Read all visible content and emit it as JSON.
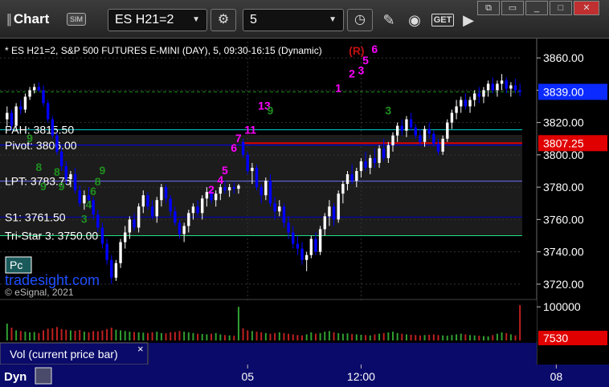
{
  "toolbar": {
    "app_title": "Chart",
    "sim_badge": "SIM",
    "symbol": "ES H21=2",
    "interval": "5",
    "get_label": "GET"
  },
  "chart_header": "* ES H21=2, S&P 500 FUTURES E-MINI (DAY), 5, 09:30-16:15 (Dynamic)",
  "watermark": {
    "brand": "tradesight.com",
    "copyright": "© eSignal, 2021",
    "pc_badge": "Pc"
  },
  "volume_panel": {
    "label": "Vol (current price bar)",
    "close_x": "×",
    "last_volume": "7530"
  },
  "footer": {
    "dyn_label": "Dyn"
  },
  "colors": {
    "up": "#ffffff",
    "down": "#0000ff",
    "setup_green": "#1f8f1f",
    "setup_magenta": "#ff00ff",
    "price_marker": "#e00000",
    "last_price": "#0a2aff"
  },
  "chart_data": {
    "type": "candlestick",
    "ylim": [
      3711,
      3870
    ],
    "y_ticks": [
      "3720.00",
      "3740.00",
      "3760.00",
      "3780.00",
      "3800.00",
      "3820.00",
      "3840.00",
      "3860.00"
    ],
    "x_ticks": [
      {
        "label": "05",
        "bar": 53
      },
      {
        "label": "12:00",
        "bar": 78
      },
      {
        "label": "08",
        "bar": 121
      }
    ],
    "last_price": {
      "label": "3839.00",
      "value": 3839.0
    },
    "marker_price": {
      "label": "3807.25",
      "value": 3807.25
    },
    "levels": [
      {
        "label": "PAH: 3815.50",
        "value": 3815.5,
        "color": "#00d0d0"
      },
      {
        "label": "Pivot: 3806.00",
        "value": 3806.0,
        "color": "#0000ff"
      },
      {
        "label": "LPT: 3783.75",
        "value": 3783.75,
        "color": "#7070ff"
      },
      {
        "label": "S1: 3761.50",
        "value": 3761.5,
        "color": "#0000c0"
      },
      {
        "label": "Tri-Star 3: 3750.00",
        "value": 3750.0,
        "color": "#20e080"
      }
    ],
    "volume_ticks": [
      "100000"
    ],
    "volume_max": 110000,
    "bars": [
      [
        3822,
        3830,
        3818,
        3826
      ],
      [
        3826,
        3828,
        3815,
        3818
      ],
      [
        3818,
        3832,
        3815,
        3830
      ],
      [
        3830,
        3834,
        3825,
        3828
      ],
      [
        3828,
        3838,
        3826,
        3836
      ],
      [
        3836,
        3842,
        3834,
        3840
      ],
      [
        3840,
        3844,
        3838,
        3842
      ],
      [
        3842,
        3845,
        3839,
        3840
      ],
      [
        3840,
        3843,
        3830,
        3832
      ],
      [
        3832,
        3834,
        3820,
        3822
      ],
      [
        3822,
        3824,
        3810,
        3812
      ],
      [
        3812,
        3814,
        3800,
        3802
      ],
      [
        3802,
        3805,
        3790,
        3793
      ],
      [
        3793,
        3796,
        3782,
        3785
      ],
      [
        3785,
        3790,
        3780,
        3788
      ],
      [
        3788,
        3792,
        3776,
        3778
      ],
      [
        3778,
        3781,
        3768,
        3770
      ],
      [
        3770,
        3778,
        3766,
        3775
      ],
      [
        3775,
        3780,
        3770,
        3772
      ],
      [
        3772,
        3774,
        3760,
        3763
      ],
      [
        3763,
        3766,
        3752,
        3755
      ],
      [
        3755,
        3758,
        3742,
        3745
      ],
      [
        3745,
        3748,
        3732,
        3735
      ],
      [
        3735,
        3738,
        3720,
        3724
      ],
      [
        3724,
        3735,
        3722,
        3733
      ],
      [
        3733,
        3748,
        3730,
        3746
      ],
      [
        3746,
        3756,
        3742,
        3752
      ],
      [
        3752,
        3762,
        3748,
        3760
      ],
      [
        3760,
        3764,
        3753,
        3755
      ],
      [
        3755,
        3770,
        3752,
        3768
      ],
      [
        3768,
        3778,
        3764,
        3775
      ],
      [
        3775,
        3777,
        3766,
        3768
      ],
      [
        3768,
        3772,
        3760,
        3762
      ],
      [
        3762,
        3774,
        3758,
        3772
      ],
      [
        3772,
        3782,
        3768,
        3780
      ],
      [
        3780,
        3782,
        3770,
        3773
      ],
      [
        3773,
        3775,
        3762,
        3765
      ],
      [
        3765,
        3768,
        3756,
        3758
      ],
      [
        3758,
        3760,
        3748,
        3751
      ],
      [
        3751,
        3758,
        3746,
        3756
      ],
      [
        3756,
        3766,
        3752,
        3764
      ],
      [
        3764,
        3770,
        3760,
        3768
      ],
      [
        3768,
        3772,
        3762,
        3764
      ],
      [
        3764,
        3775,
        3760,
        3773
      ],
      [
        3773,
        3780,
        3768,
        3777
      ],
      [
        3777,
        3779,
        3770,
        3772
      ],
      [
        3772,
        3778,
        3768,
        3776
      ],
      [
        3776,
        3782,
        3772,
        3780
      ],
      [
        3780,
        3784,
        3776,
        3778
      ],
      [
        3778,
        3782,
        3774,
        3780
      ],
      [
        3780,
        3783,
        3776,
        3779
      ],
      [
        3779,
        3782,
        3776,
        3781
      ],
      [
        3808,
        3810,
        3798,
        3800
      ],
      [
        3800,
        3802,
        3788,
        3790
      ],
      [
        3790,
        3795,
        3782,
        3792
      ],
      [
        3792,
        3794,
        3778,
        3780
      ],
      [
        3780,
        3782,
        3770,
        3775
      ],
      [
        3775,
        3786,
        3772,
        3784
      ],
      [
        3784,
        3788,
        3768,
        3770
      ],
      [
        3770,
        3774,
        3760,
        3765
      ],
      [
        3765,
        3772,
        3762,
        3768
      ],
      [
        3768,
        3770,
        3755,
        3758
      ],
      [
        3758,
        3762,
        3748,
        3752
      ],
      [
        3752,
        3756,
        3742,
        3745
      ],
      [
        3745,
        3750,
        3738,
        3742
      ],
      [
        3742,
        3746,
        3732,
        3735
      ],
      [
        3735,
        3740,
        3728,
        3738
      ],
      [
        3738,
        3750,
        3736,
        3748
      ],
      [
        3748,
        3752,
        3738,
        3740
      ],
      [
        3740,
        3756,
        3738,
        3754
      ],
      [
        3754,
        3764,
        3750,
        3762
      ],
      [
        3762,
        3772,
        3756,
        3768
      ],
      [
        3768,
        3770,
        3756,
        3760
      ],
      [
        3760,
        3778,
        3758,
        3776
      ],
      [
        3776,
        3784,
        3770,
        3782
      ],
      [
        3782,
        3790,
        3778,
        3788
      ],
      [
        3788,
        3794,
        3782,
        3784
      ],
      [
        3784,
        3792,
        3780,
        3790
      ],
      [
        3790,
        3798,
        3786,
        3796
      ],
      [
        3796,
        3802,
        3790,
        3792
      ],
      [
        3792,
        3800,
        3788,
        3798
      ],
      [
        3798,
        3804,
        3792,
        3795
      ],
      [
        3795,
        3806,
        3792,
        3804
      ],
      [
        3804,
        3810,
        3796,
        3798
      ],
      [
        3798,
        3808,
        3795,
        3806
      ],
      [
        3806,
        3814,
        3802,
        3812
      ],
      [
        3812,
        3820,
        3808,
        3818
      ],
      [
        3818,
        3822,
        3812,
        3815
      ],
      [
        3815,
        3824,
        3811,
        3822
      ],
      [
        3822,
        3826,
        3815,
        3817
      ],
      [
        3817,
        3819,
        3810,
        3812
      ],
      [
        3812,
        3816,
        3806,
        3808
      ],
      [
        3808,
        3818,
        3805,
        3816
      ],
      [
        3816,
        3820,
        3810,
        3813
      ],
      [
        3813,
        3815,
        3805,
        3807
      ],
      [
        3807,
        3810,
        3800,
        3802
      ],
      [
        3802,
        3812,
        3800,
        3810
      ],
      [
        3810,
        3822,
        3808,
        3820
      ],
      [
        3820,
        3828,
        3816,
        3826
      ],
      [
        3826,
        3834,
        3822,
        3830
      ],
      [
        3830,
        3836,
        3826,
        3834
      ],
      [
        3834,
        3838,
        3828,
        3830
      ],
      [
        3830,
        3836,
        3826,
        3834
      ],
      [
        3834,
        3840,
        3830,
        3838
      ],
      [
        3838,
        3842,
        3832,
        3836
      ],
      [
        3836,
        3842,
        3832,
        3840
      ],
      [
        3840,
        3846,
        3836,
        3844
      ],
      [
        3844,
        3848,
        3838,
        3840
      ],
      [
        3840,
        3846,
        3836,
        3844
      ],
      [
        3844,
        3850,
        3840,
        3846
      ],
      [
        3846,
        3848,
        3838,
        3841
      ],
      [
        3841,
        3845,
        3836,
        3843
      ],
      [
        3843,
        3847,
        3838,
        3840
      ],
      [
        3840,
        3844,
        3836,
        3839
      ]
    ],
    "volumes": [
      50000,
      38000,
      30000,
      28000,
      26000,
      24000,
      25000,
      22000,
      30000,
      35000,
      36000,
      40000,
      34000,
      32000,
      30000,
      29000,
      31000,
      26000,
      24000,
      28000,
      27000,
      30000,
      34000,
      38000,
      32000,
      30000,
      28000,
      26000,
      25000,
      24000,
      23000,
      22000,
      24000,
      26000,
      22000,
      21000,
      24000,
      25000,
      28000,
      26000,
      24000,
      22000,
      20000,
      19000,
      18000,
      20000,
      22000,
      18000,
      16000,
      15000,
      14000,
      100000,
      36000,
      30000,
      28000,
      26000,
      24000,
      22000,
      20000,
      22000,
      24000,
      22000,
      20000,
      18000,
      16000,
      15000,
      18000,
      24000,
      20000,
      22000,
      26000,
      28000,
      24000,
      22000,
      20000,
      21000,
      19000,
      18000,
      17000,
      16000,
      15000,
      18000,
      20000,
      22000,
      24000,
      26000,
      22000,
      20000,
      18000,
      17000,
      16000,
      15000,
      16000,
      17000,
      18000,
      16000,
      15000,
      14000,
      16000,
      18000,
      20000,
      18000,
      16000,
      15000,
      14000,
      13000,
      12000,
      16000,
      20000,
      24000,
      22000,
      18000,
      15000,
      105000,
      20000,
      18000,
      16000,
      7530
    ],
    "annotations": [
      {
        "bar": 5,
        "value": 3808,
        "text": "9",
        "color": "green"
      },
      {
        "bar": 7,
        "value": 3790,
        "text": "8",
        "color": "green"
      },
      {
        "bar": 8,
        "value": 3778,
        "text": "9",
        "color": "green"
      },
      {
        "bar": 11,
        "value": 3787,
        "text": "8",
        "color": "green"
      },
      {
        "bar": 12,
        "value": 3778,
        "text": "9",
        "color": "green"
      },
      {
        "bar": 17,
        "value": 3758,
        "text": "3",
        "color": "green"
      },
      {
        "bar": 18,
        "value": 3767,
        "text": "4",
        "color": "green"
      },
      {
        "bar": 19,
        "value": 3775,
        "text": "6",
        "color": "green"
      },
      {
        "bar": 20,
        "value": 3781,
        "text": "8",
        "color": "green"
      },
      {
        "bar": 21,
        "value": 3788,
        "text": "9",
        "color": "green"
      },
      {
        "bar": 45,
        "value": 3776,
        "text": "2",
        "color": "magenta"
      },
      {
        "bar": 47,
        "value": 3782,
        "text": "4",
        "color": "magenta"
      },
      {
        "bar": 48,
        "value": 3788,
        "text": "5",
        "color": "magenta"
      },
      {
        "bar": 50,
        "value": 3802,
        "text": "6",
        "color": "magenta"
      },
      {
        "bar": 51,
        "value": 3808,
        "text": "7",
        "color": "magenta"
      },
      {
        "bar": 53,
        "value": 3813,
        "text": "11",
        "color": "magenta"
      },
      {
        "bar": 56,
        "value": 3828,
        "text": "13",
        "color": "magenta"
      },
      {
        "bar": 58,
        "value": 3825,
        "text": "9",
        "color": "green"
      },
      {
        "bar": 76,
        "value": 3848,
        "text": "2",
        "color": "magenta"
      },
      {
        "bar": 78,
        "value": 3850,
        "text": "3",
        "color": "magenta"
      },
      {
        "bar": 79,
        "value": 3856,
        "text": "5",
        "color": "magenta"
      },
      {
        "bar": 76,
        "value": 3862,
        "text": "(R)",
        "color": "red"
      },
      {
        "bar": 81,
        "value": 3863,
        "text": "6",
        "color": "magenta"
      },
      {
        "bar": 73,
        "value": 3839,
        "text": "1",
        "color": "magenta"
      },
      {
        "bar": 84,
        "value": 3825,
        "text": "3",
        "color": "green"
      }
    ]
  }
}
